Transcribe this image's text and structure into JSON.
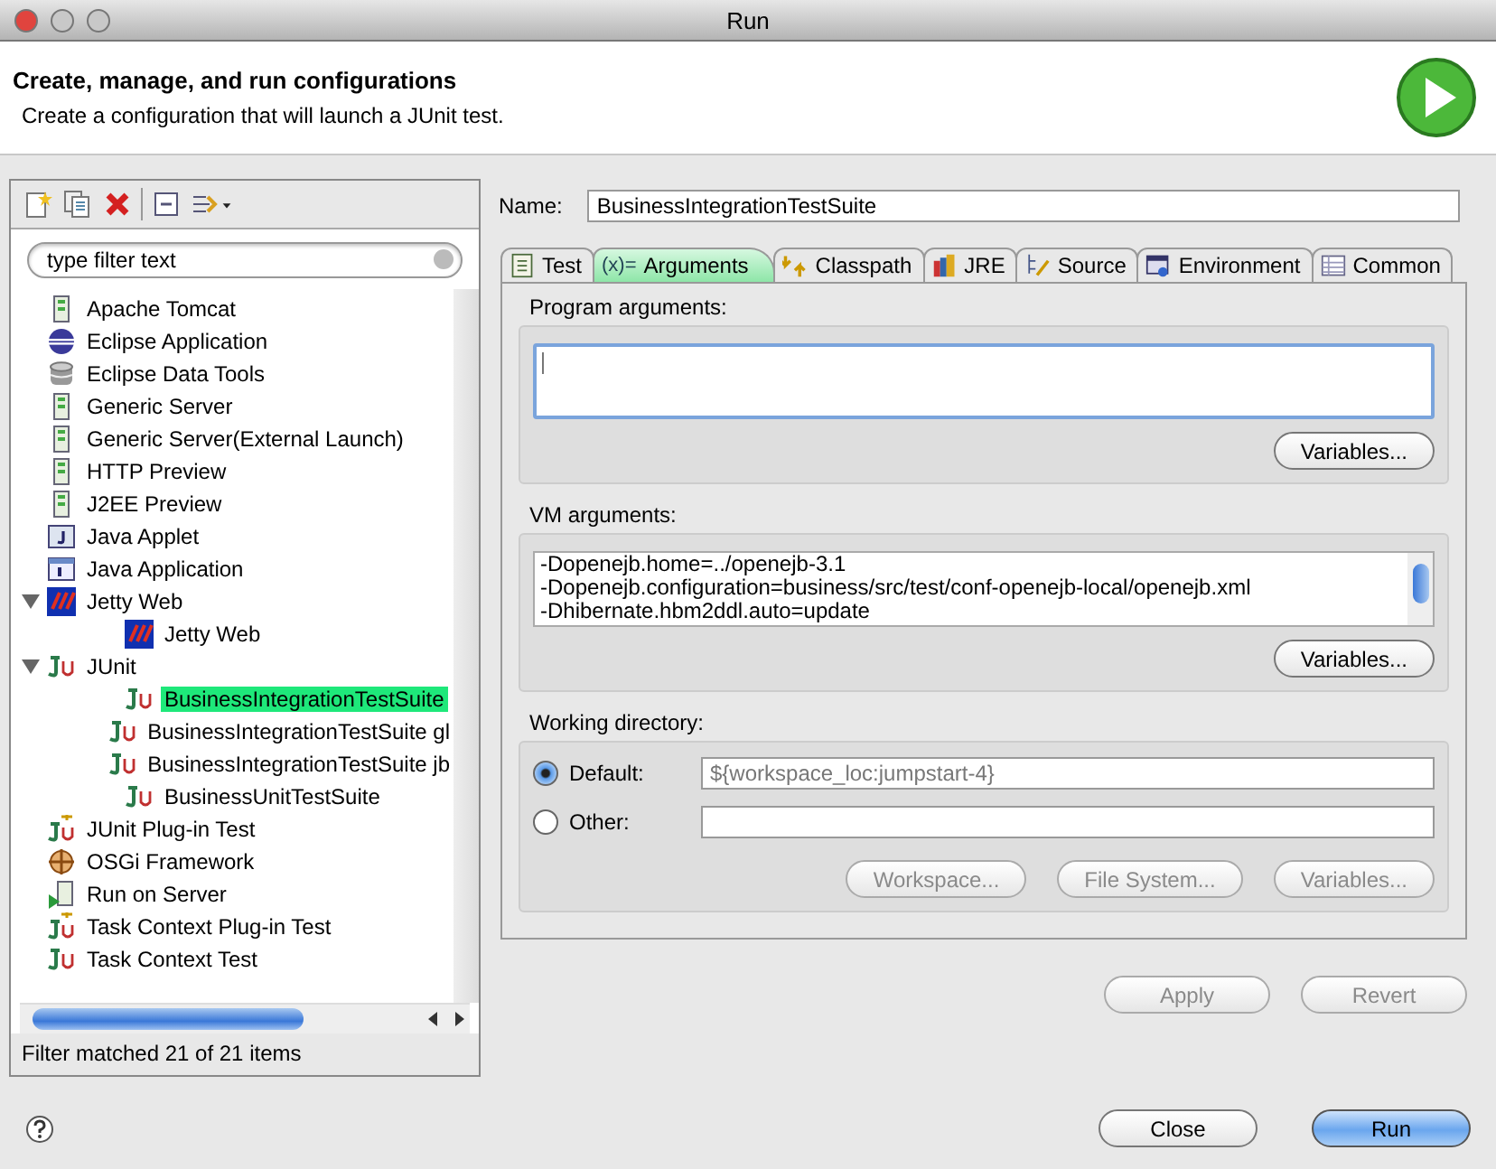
{
  "window": {
    "title": "Run"
  },
  "header": {
    "title": "Create, manage, and run configurations",
    "subtitle": "Create a configuration that will launch a JUnit test."
  },
  "filter": {
    "placeholder": "type filter text"
  },
  "tree": [
    {
      "label": "Apache Tomcat",
      "kind": "server",
      "selected": false
    },
    {
      "label": "Eclipse Application",
      "kind": "eclipse",
      "selected": false
    },
    {
      "label": "Eclipse Data Tools",
      "kind": "database",
      "selected": false
    },
    {
      "label": "Generic Server",
      "kind": "server",
      "selected": false
    },
    {
      "label": "Generic Server(External Launch)",
      "kind": "server",
      "selected": false
    },
    {
      "label": "HTTP Preview",
      "kind": "server",
      "selected": false
    },
    {
      "label": "J2EE Preview",
      "kind": "server",
      "selected": false
    },
    {
      "label": "Java Applet",
      "kind": "applet",
      "selected": false
    },
    {
      "label": "Java Application",
      "kind": "java",
      "selected": false
    },
    {
      "label": "Jetty Web",
      "kind": "jetty",
      "selected": false,
      "expanded": true,
      "children": [
        {
          "label": "Jetty Web",
          "kind": "jetty",
          "selected": false
        }
      ]
    },
    {
      "label": "JUnit",
      "kind": "junit",
      "selected": false,
      "expanded": true,
      "children": [
        {
          "label": "BusinessIntegrationTestSuite",
          "kind": "junit",
          "selected": true
        },
        {
          "label": "BusinessIntegrationTestSuite gl",
          "kind": "junit",
          "selected": false
        },
        {
          "label": "BusinessIntegrationTestSuite jb",
          "kind": "junit",
          "selected": false
        },
        {
          "label": "BusinessUnitTestSuite",
          "kind": "junit",
          "selected": false
        }
      ]
    },
    {
      "label": "JUnit Plug-in Test",
      "kind": "junit-plugin",
      "selected": false
    },
    {
      "label": "OSGi Framework",
      "kind": "osgi",
      "selected": false
    },
    {
      "label": "Run on Server",
      "kind": "run-server",
      "selected": false
    },
    {
      "label": "Task Context Plug-in Test",
      "kind": "junit-plugin",
      "selected": false
    },
    {
      "label": "Task Context Test",
      "kind": "junit",
      "selected": false
    }
  ],
  "filter_status": "Filter matched 21 of 21 items",
  "name_field": {
    "label": "Name:",
    "value": "BusinessIntegrationTestSuite"
  },
  "tabs": [
    {
      "label": "Test",
      "kind": "doc",
      "selected": false
    },
    {
      "label": "Arguments",
      "kind": "text",
      "icon_text": "(x)=",
      "selected": true
    },
    {
      "label": "Classpath",
      "kind": "arrows",
      "selected": false
    },
    {
      "label": "JRE",
      "kind": "books",
      "selected": false
    },
    {
      "label": "Source",
      "kind": "tree",
      "selected": false
    },
    {
      "label": "Environment",
      "kind": "window",
      "selected": false
    },
    {
      "label": "Common",
      "kind": "table",
      "selected": false
    }
  ],
  "program_arguments": {
    "label": "Program arguments:",
    "button": "Variables..."
  },
  "vm_arguments": {
    "label": "VM arguments:",
    "lines": [
      "-Dopenejb.home=../openejb-3.1",
      "-Dopenejb.configuration=business/src/test/conf-openejb-local/openejb.xml",
      "-Dhibernate.hbm2ddl.auto=update"
    ],
    "button": "Variables..."
  },
  "working_directory": {
    "label": "Working directory:",
    "options": [
      {
        "label": "Default:",
        "selected": true,
        "value": "${workspace_loc:jumpstart-4}",
        "disabled": true
      },
      {
        "label": "Other:",
        "selected": false,
        "disabled": false
      }
    ],
    "buttons": [
      {
        "label": "Workspace...",
        "disabled": true
      },
      {
        "label": "File System...",
        "disabled": true
      },
      {
        "label": "Variables...",
        "disabled": true
      }
    ]
  },
  "actions": [
    {
      "label": "Apply",
      "disabled": true
    },
    {
      "label": "Revert",
      "disabled": true
    }
  ],
  "footer_buttons": [
    {
      "label": "Close",
      "kind": "normal"
    },
    {
      "label": "Run",
      "kind": "default"
    }
  ]
}
